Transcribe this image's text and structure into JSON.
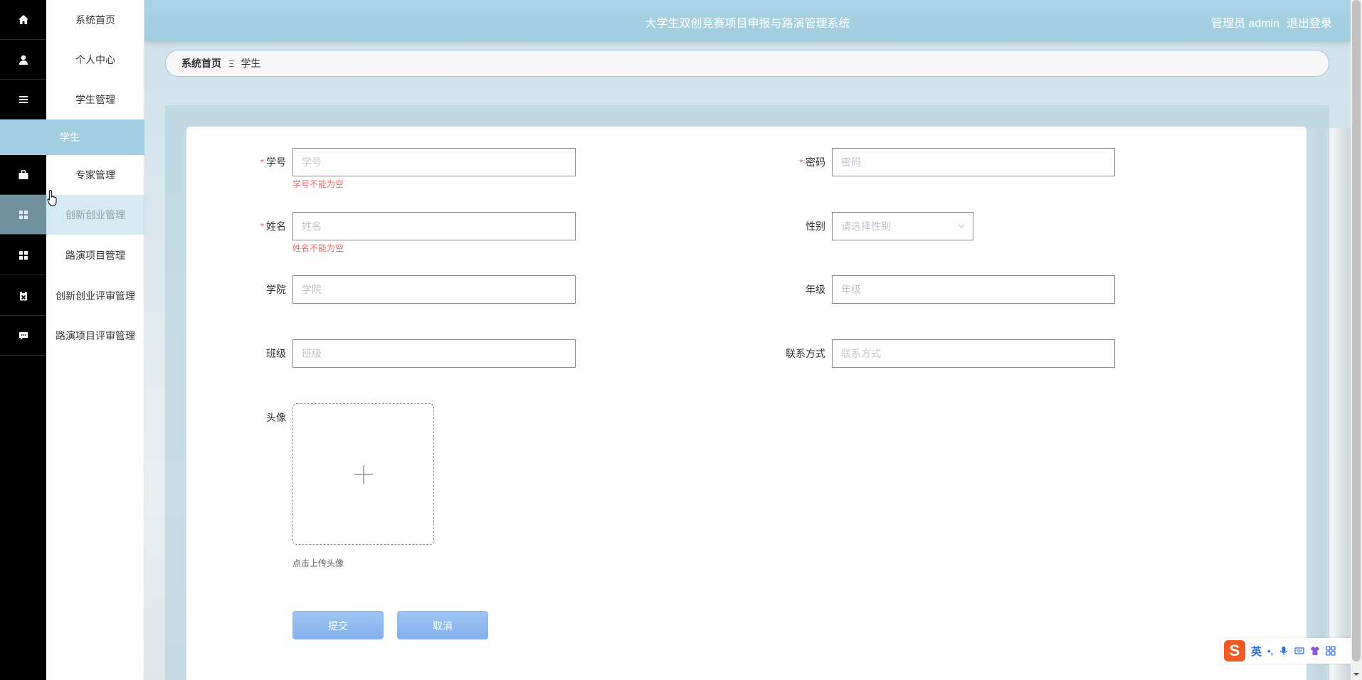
{
  "header": {
    "title": "大学生双创竞赛项目申报与路演管理系统",
    "user": "管理员 admin",
    "logout": "退出登录"
  },
  "sidebar": {
    "items": [
      {
        "label": "系统首页",
        "icon": "home-icon"
      },
      {
        "label": "个人中心",
        "icon": "user-icon"
      },
      {
        "label": "学生管理",
        "icon": "list-icon"
      },
      {
        "label": "专家管理",
        "icon": "briefcase-icon"
      },
      {
        "label": "创新创业管理",
        "icon": "grid-icon"
      },
      {
        "label": "路演项目管理",
        "icon": "grid-icon"
      },
      {
        "label": "创新创业评审管理",
        "icon": "clipboard-icon"
      },
      {
        "label": "路演项目评审管理",
        "icon": "chat-icon"
      }
    ],
    "active_sub": "学生"
  },
  "breadcrumb": {
    "home": "系统首页",
    "separator": "Ξ",
    "current": "学生"
  },
  "form": {
    "student_id": {
      "label": "学号",
      "placeholder": "学号",
      "error": "学号不能为空"
    },
    "password": {
      "label": "密码",
      "placeholder": "密码"
    },
    "name": {
      "label": "姓名",
      "placeholder": "姓名",
      "error": "姓名不能为空"
    },
    "gender": {
      "label": "性别",
      "placeholder": "请选择性别"
    },
    "college": {
      "label": "学院",
      "placeholder": "学院"
    },
    "grade": {
      "label": "年级",
      "placeholder": "年级"
    },
    "class": {
      "label": "班级",
      "placeholder": "班级"
    },
    "contact": {
      "label": "联系方式",
      "placeholder": "联系方式"
    },
    "avatar": {
      "label": "头像",
      "tip": "点击上传头像"
    },
    "required_mark": "*",
    "submit": "提交",
    "cancel": "取消"
  },
  "ime": {
    "logo": "S",
    "lang": "英",
    "punct": "•,"
  },
  "colors": {
    "accent": "#a3cde0",
    "error": "#f56c6c",
    "button": "#8db6ee"
  }
}
